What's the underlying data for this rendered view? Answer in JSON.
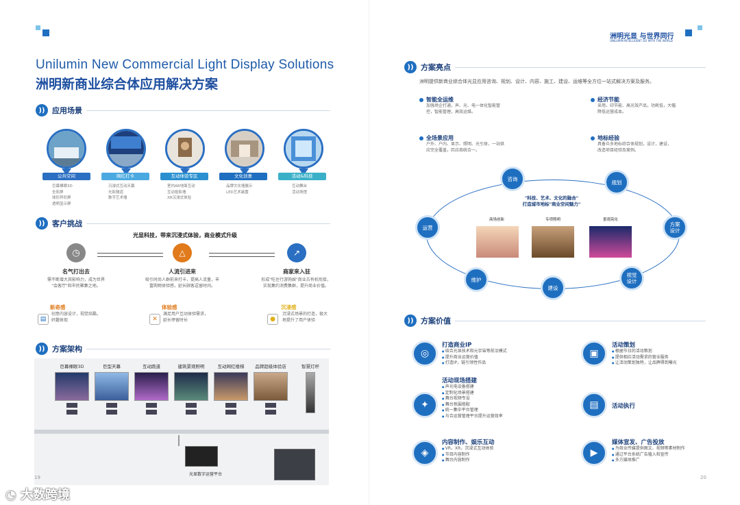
{
  "left": {
    "title_en": "Unilumin New Commercial Light Display Solutions",
    "title_cn": "洲明新商业综合体应用解决方案",
    "sec_scenes": "应用场景",
    "scenes": [
      {
        "tag": "公共空间",
        "desc": [
          "巨幕裸眼3D",
          "全彩屏",
          "球形异形屏",
          "透明显示屏"
        ],
        "color": "#2a6fc2"
      },
      {
        "tag": "网红打卡",
        "desc": [
          "沉浸式互动天幕",
          "光影隧道",
          "数字艺术墙"
        ],
        "color": "#4aa9e0"
      },
      {
        "tag": "互动体验专区",
        "desc": [
          "室内AR地面互动",
          "互动投影墙",
          "XR沉浸式体验"
        ],
        "color": "#2a8fd0"
      },
      {
        "tag": "文化创意",
        "desc": [
          "品牌文化墙展示",
          "LED艺术装置"
        ],
        "color": "#1f6fc0"
      },
      {
        "tag": "活动&科技",
        "desc": [
          "互动舞台",
          "活动场馆"
        ],
        "color": "#3ab0c8"
      }
    ],
    "sec_challenge": "客户挑战",
    "challenge_headline": "光显科技，带来沉浸式体验，商业模式升级",
    "challenges": [
      {
        "title": "名气打出去",
        "desc": "需不断增大其影响力，成为世界\n\"会客厅\"和市民聚集之地。"
      },
      {
        "title": "人流引进来",
        "desc": "吸引时尚人群前来打卡，提高人流量，丰\n富购物体验感，延长顾客逗留时间。"
      },
      {
        "title": "商家来入驻",
        "desc": "形成\"吃住行游购娱\"商业古有机衔接，\n实现集约消费集群，提升商业价值。"
      }
    ],
    "features": [
      {
        "title": "新奇感",
        "desc": "创意内容设计，视觉炫酷，\n奸趣体现",
        "color": "#e07a1a"
      },
      {
        "title": "体验感",
        "desc": "满足用户互动体验需求，\n延长停留时长",
        "color": "#e07a1a"
      },
      {
        "title": "沉浸感",
        "desc": "沉浸式场景的打造，极大\n地提升了用户体验",
        "color": "#e0b01a"
      }
    ],
    "sec_arch": "方案架构",
    "arch_cols": [
      "巨幕裸眼3D",
      "巨型天幕",
      "互动跑道",
      "建筑景观照明",
      "互动网红楼梯",
      "品牌超级体验店",
      "智慧灯杆"
    ],
    "arch_center_label": "光显数字运营平台",
    "page_no": "19"
  },
  "right": {
    "brand_cn": "洲明光显 与世界同行",
    "brand_en": "UNILUMIN INTELLIGENT GO WITH THE WORLD",
    "sec_highlights": "方案亮点",
    "intro": "洲明提供新商业综合体光显应用咨询、规划、设计、内容、施工、建设、运维等全方位一站式解决方案及服务。",
    "highlights": [
      {
        "title": "智能全运维",
        "desc": "加强场企打通，声、光、电一体化智能管\n控，智能管理，高效运维。"
      },
      {
        "title": "经济节能",
        "desc": "采用、印节能、高光效产品，功耗低，大幅\n降低运营成本。"
      },
      {
        "title": "全场景应用",
        "desc": "户外、户内、显示、照明、光引体，一站供\n应完全覆盖，匹应商统合一。"
      },
      {
        "title": "地标经验",
        "desc": "具备众多地标综合体规划，设计，建设，\n改造项目经验及案例。"
      }
    ],
    "cycle_center": "\"科技、艺术、文化的融合\"\n打造城市地标\"商业空间魅力\"",
    "cycle_nodes": [
      "咨询",
      "规划",
      "方案\n设计",
      "视觉\n设计",
      "建设",
      "维护",
      "运营"
    ],
    "cycle_photos": [
      "商场创新",
      "专项照明",
      "景观亮化"
    ],
    "sec_value": "方案价值",
    "values": [
      {
        "title": "打造商业IP",
        "icon": "◎",
        "items": [
          "结合光显技术和元宇宙等前沿模式",
          "提升商业运营价值",
          "打造IP，链引领性作品"
        ]
      },
      {
        "title": "活动策划",
        "icon": "▣",
        "items": [
          "根据节日的活动策划",
          "提供相应活动需求的营业服务",
          "让活动策划独特，让品牌得到曝光"
        ]
      },
      {
        "title": "活动现场搭建",
        "icon": "✦",
        "items": [
          "声光电设备搭建",
          "定制化场景搭建",
          "舞台视频专设",
          "舞台氛围搭配",
          "统一集中平台管理",
          "与合运营管理平台提升运营效率"
        ]
      },
      {
        "title": "活动执行",
        "icon": "▤",
        "items": []
      },
      {
        "title": "内容制作、娱乐互动",
        "icon": "◈",
        "items": [
          "VR，XR，沉浸式互动体验",
          "节目内容制作",
          "舞台内容制作"
        ]
      },
      {
        "title": "媒体宣发、广告投放",
        "icon": "▶",
        "items": [
          "为商业传媒提供图文、视频等素材制作",
          "通过平台系统广告植入和宣传",
          "多方媒体推广"
        ]
      }
    ],
    "page_no": "20"
  },
  "watermark": "大数跨境",
  "colors": {
    "primary": "#1f6fc0",
    "dark": "#1a3f7a",
    "accent": "#e07a1a"
  }
}
